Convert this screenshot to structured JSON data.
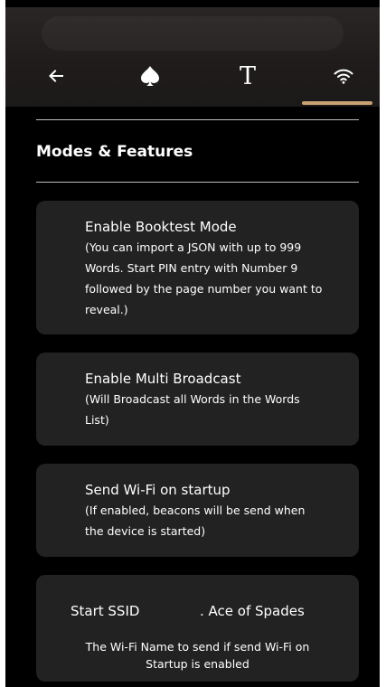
{
  "nav": {
    "back_icon": "arrow-left-icon",
    "spade_icon": "spade-icon",
    "text_icon_glyph": "T",
    "wifi_icon": "wifi-icon",
    "indicator_color": "#c9a173"
  },
  "section": {
    "title": "Modes & Features"
  },
  "cards": [
    {
      "title": "Enable Booktest Mode",
      "description": "(You can import a JSON with up to 999 Words. Start PIN entry with Number 9 followed by the page number you want to reveal.)"
    },
    {
      "title": "Enable Multi Broadcast",
      "description": "(Will Broadcast all Words in the Words List)"
    },
    {
      "title": "Send Wi-Fi on startup",
      "description": "(If enabled, beacons will be send when the device is started)"
    }
  ],
  "ssid": {
    "label": "Start SSID",
    "value": ". Ace of Spades",
    "help": "The Wi-Fi Name to send if send Wi-Fi on Startup is enabled"
  }
}
